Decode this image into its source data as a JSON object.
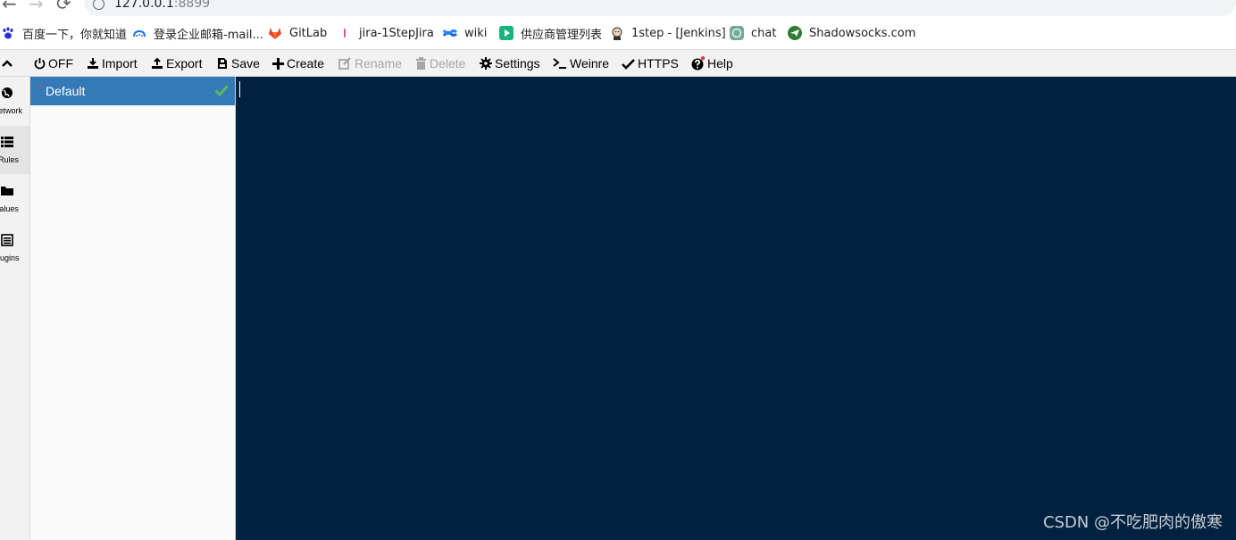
{
  "browser": {
    "url_host": "127.0.0.1",
    "url_port": ":8899"
  },
  "bookmarks": [
    {
      "label": "百度一下，你就知道",
      "icon": "baidu-paw-icon"
    },
    {
      "label": "登录企业邮箱-mail...",
      "icon": "mail-cloud-icon"
    },
    {
      "label": "GitLab",
      "icon": "gitlab-fox-icon"
    },
    {
      "label": "jira-1StepJira",
      "icon": "jira-icon"
    },
    {
      "label": "wiki",
      "icon": "confluence-icon"
    },
    {
      "label": "供应商管理列表",
      "icon": "play-icon"
    },
    {
      "label": "1step - [Jenkins]",
      "icon": "jenkins-icon"
    },
    {
      "label": "chat",
      "icon": "chatgpt-icon"
    },
    {
      "label": "Shadowsocks.com",
      "icon": "paper-plane-icon"
    }
  ],
  "toolbar": {
    "off": "OFF",
    "import": "Import",
    "export": "Export",
    "save": "Save",
    "create": "Create",
    "rename": "Rename",
    "delete": "Delete",
    "settings": "Settings",
    "weinre": "Weinre",
    "https": "HTTPS",
    "help": "Help"
  },
  "rail": {
    "network": "Network",
    "rules": "Rules",
    "values": "Values",
    "plugins": "Plugins"
  },
  "rules": [
    {
      "name": "Default",
      "modified_marker": "*",
      "active": true
    }
  ],
  "watermark": "CSDN @不吃肥肉的傲寒",
  "colors": {
    "accent": "#337ab7",
    "editor_bg": "#002240",
    "check": "#5cb85c"
  }
}
